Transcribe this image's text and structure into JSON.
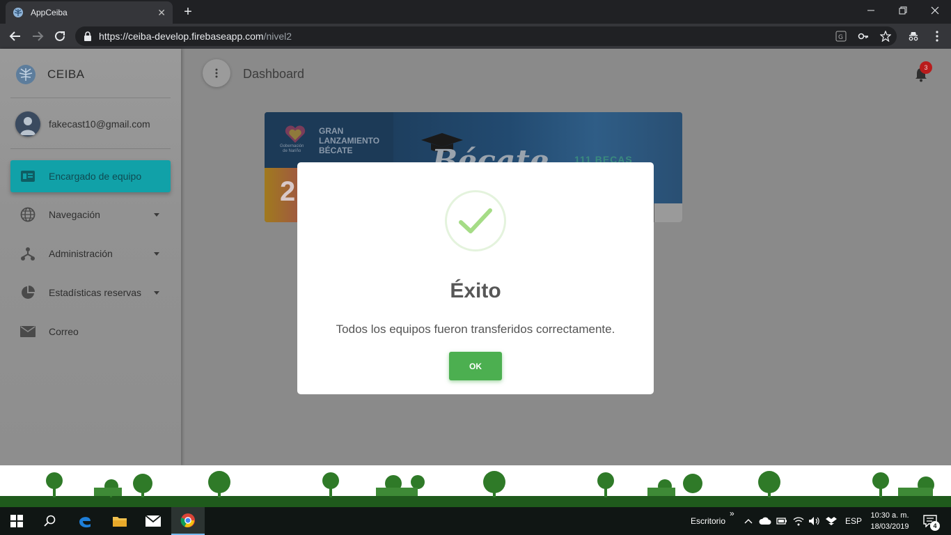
{
  "browser": {
    "tab_title": "AppCeiba",
    "new_tab_label": "+",
    "url_host": "https://ceiba-develop.firebaseapp.com",
    "url_path": "/nivel2"
  },
  "sidebar": {
    "brand": "CEIBA",
    "user_email": "fakecast10@gmail.com",
    "items": [
      {
        "label": "Encargado de equipo",
        "icon": "id-card-icon",
        "active": true
      },
      {
        "label": "Navegación",
        "icon": "globe-icon",
        "expandable": true
      },
      {
        "label": "Administración",
        "icon": "hierarchy-icon",
        "expandable": true
      },
      {
        "label": "Estadísticas reservas",
        "icon": "pie-chart-icon",
        "expandable": true
      },
      {
        "label": "Correo",
        "icon": "mail-icon"
      }
    ]
  },
  "main": {
    "page_title": "Dashboard",
    "notifications_count": "3",
    "banner": {
      "headline": [
        "GRAN",
        "LANZAMIENTO",
        "BÉCATE"
      ],
      "org": [
        "Gobernación",
        "de Nariño"
      ],
      "script_word": "Bécate",
      "becas_text": "111 BECAS",
      "number_fragment": "2"
    }
  },
  "modal": {
    "title": "Éxito",
    "message": "Todos los equipos fueron transferidos correctamente.",
    "ok_label": "OK",
    "icon": "check-icon"
  },
  "taskbar": {
    "desktop_label": "Escritorio",
    "chevron": "»",
    "language": "ESP",
    "time": "10:30 a. m.",
    "date": "18/03/2019",
    "notification_count": "4"
  },
  "colors": {
    "accent_teal": "#11a1a8",
    "success_green": "#4caf50",
    "badge_red": "#b91c1c"
  }
}
